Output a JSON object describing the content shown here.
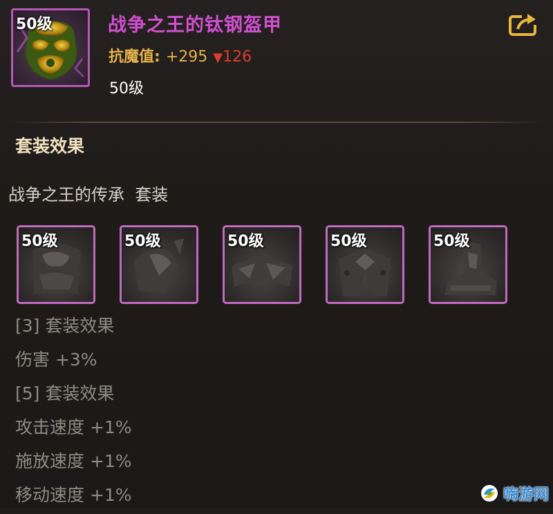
{
  "item": {
    "level_badge": "50级",
    "name": "战争之王的钛钢盔甲",
    "stat_label": "抗魔值:",
    "stat_value": "+295",
    "stat_diff_marker": "▼",
    "stat_diff": "126",
    "level_text": "50级"
  },
  "section": {
    "title": "套装效果",
    "set_name": "战争之王的传承  套装"
  },
  "set_items": [
    {
      "level": "50级",
      "icon": "armor-piece-icon"
    },
    {
      "level": "50级",
      "icon": "shoulder-piece-icon"
    },
    {
      "level": "50级",
      "icon": "belt-piece-icon"
    },
    {
      "level": "50级",
      "icon": "pants-piece-icon"
    },
    {
      "level": "50级",
      "icon": "boots-piece-icon"
    }
  ],
  "effects": [
    "[3] 套装效果",
    "伤害 +3%",
    "[5] 套装效果",
    "攻击速度 +1%",
    "施放速度 +1%",
    "移动速度 +1%"
  ],
  "watermark": {
    "text": "嗨游网",
    "icon": "site-logo-icon"
  },
  "colors": {
    "item_name": "#d04fd0",
    "stat": "#e6b24a",
    "stat_down": "#e03b2b",
    "frame": "#c16ac2",
    "section_title": "#f0e2bf",
    "effect_text": "#8f8a83"
  }
}
